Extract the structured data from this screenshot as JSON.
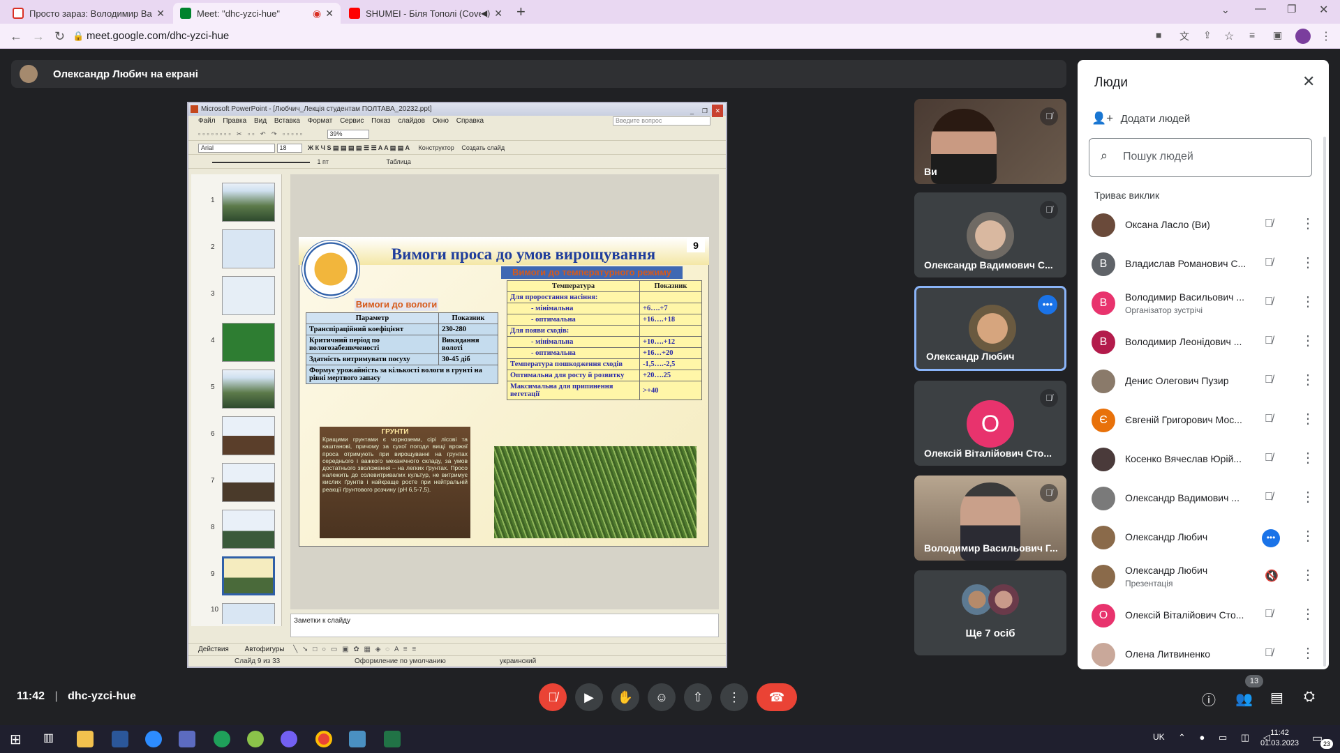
{
  "browser": {
    "tabs": [
      {
        "title": "Просто зараз: Володимир Васи..."
      },
      {
        "title": "Meet: \"dhc-yzci-hue\""
      },
      {
        "title": "SHUMEI - Біля Тополі (Cove..."
      }
    ],
    "url": "meet.google.com/dhc-yzci-hue"
  },
  "meet": {
    "presenter_banner": "Олександр Любич на екрані",
    "time": "11:42",
    "meeting_code": "dhc-yzci-hue",
    "participants_badge": "13",
    "tiles": [
      {
        "name": "Ви"
      },
      {
        "name": "Олександр Вадимович С..."
      },
      {
        "name": "Олександр Любич"
      },
      {
        "name": "Олексій Віталійович Сто...",
        "initial": "О"
      },
      {
        "name": "Володимир Васильович Г..."
      },
      {
        "name": "Ще 7 осіб"
      }
    ]
  },
  "powerpoint": {
    "title": "Microsoft PowerPoint - [Любчич_Лекція студентам ПОЛТАВА_20232.ppt]",
    "menu": [
      "Файл",
      "Правка",
      "Вид",
      "Вставка",
      "Формат",
      "Сервис",
      "Показ слайдов",
      "Окно",
      "Справка"
    ],
    "ask": "Введите вопрос",
    "font": "Arial",
    "size": "18",
    "zoom": "39%",
    "konstruktor": "Конструктор",
    "new_slide": "Создать слайд",
    "table_btn": "Таблица",
    "line_weight": "1 пт",
    "actions": "Действия",
    "autoshapes": "Автофигуры",
    "notes_placeholder": "Заметки к слайду",
    "status": {
      "slide": "Слайд 9 из 33",
      "design": "Оформление по умолчанию",
      "lang": "украинский"
    },
    "thumb_numbers": [
      "1",
      "2",
      "3",
      "4",
      "5",
      "6",
      "7",
      "8",
      "9",
      "10"
    ],
    "slide": {
      "number": "9",
      "title": "Вимоги проса до умов вирощування",
      "moisture_heading": "Вимоги до вологи",
      "moisture_table": {
        "headers": [
          "Параметр",
          "Показник"
        ],
        "rows": [
          [
            "Транспіраційний коефіцієнт",
            "230-280"
          ],
          [
            "Критичний період по вологозабезпеченості",
            "Викидання волоті"
          ],
          [
            "Здатність витримувати посуху",
            "30-45 діб"
          ],
          [
            "Формує урожайність за кількості вологи в грунті на рівні мертвого запасу",
            ""
          ]
        ]
      },
      "temp_heading": "Вимоги до температурного режиму",
      "temp_table": {
        "headers": [
          "Температура",
          "Показник"
        ],
        "rows": [
          [
            "Для проростання насіння:",
            ""
          ],
          [
            "- мінімальна",
            "+6….+7"
          ],
          [
            "- оптимальна",
            "+16….+18"
          ],
          [
            "Для появи сходів:",
            ""
          ],
          [
            "- мінімальна",
            "+10….+12"
          ],
          [
            "- оптимальна",
            "+16…+20"
          ],
          [
            "Температура пошкодження сходів",
            "-1,5….-2,5"
          ],
          [
            "Оптимальна для росту й розвитку",
            "+20….25"
          ],
          [
            "Максимальна для припинення вегетації",
            ">+40"
          ]
        ]
      },
      "soil_heading": "ГРУНТИ",
      "soil_text": "Кращими грунтами є чорноземи, сірі лісові та каштанові, причому за сухої погоди вищі врожаї проса отримують при вирощуванні на грунтах середнього і важкого механічного складу, за умов достатнього зволоження – на легких ґрунтах. Просо належить до солевитривалих культур, не витримує кислих ґрунтів і найкраще росте при нейтральній реакції ґрунтового розчину (pH 6,5-7,5)."
    }
  },
  "people_panel": {
    "title": "Люди",
    "add_people": "Додати людей",
    "search_placeholder": "Пошук людей",
    "section": "Триває виклик",
    "people": [
      {
        "name": "Оксана Ласло (Ви)",
        "sub": "",
        "initial": "",
        "color": "#6a4a3a"
      },
      {
        "name": "Владислав Романович С...",
        "sub": "",
        "initial": "В",
        "color": "#5f6368"
      },
      {
        "name": "Володимир Васильович ...",
        "sub": "Організатор зустрічі",
        "initial": "В",
        "color": "#e8336d"
      },
      {
        "name": "Володимир Леонідович ...",
        "sub": "",
        "initial": "В",
        "color": "#b31b4b"
      },
      {
        "name": "Денис Олегович Пузир",
        "sub": "",
        "initial": "",
        "color": "#8a7a6a"
      },
      {
        "name": "Євгеній Григорович Мос...",
        "sub": "",
        "initial": "Є",
        "color": "#e8710a"
      },
      {
        "name": "Косенко Вячеслав Юрій...",
        "sub": "",
        "initial": "",
        "color": "#4a3a3a"
      },
      {
        "name": "Олександр Вадимович ...",
        "sub": "",
        "initial": "",
        "color": "#7a7a7a"
      },
      {
        "name": "Олександр Любич",
        "sub": "",
        "initial": "",
        "color": "#8a6a4a"
      },
      {
        "name": "Олександр Любич",
        "sub": "Презентація",
        "initial": "",
        "color": "#8a6a4a"
      },
      {
        "name": "Олексій Віталійович Сто...",
        "sub": "",
        "initial": "О",
        "color": "#e8336d"
      },
      {
        "name": "Олена Литвиненко",
        "sub": "",
        "initial": "",
        "color": "#c9a89a"
      }
    ]
  },
  "taskbar": {
    "lang": "UK",
    "time": "11:42",
    "date": "01.03.2023",
    "notifications": "23"
  }
}
